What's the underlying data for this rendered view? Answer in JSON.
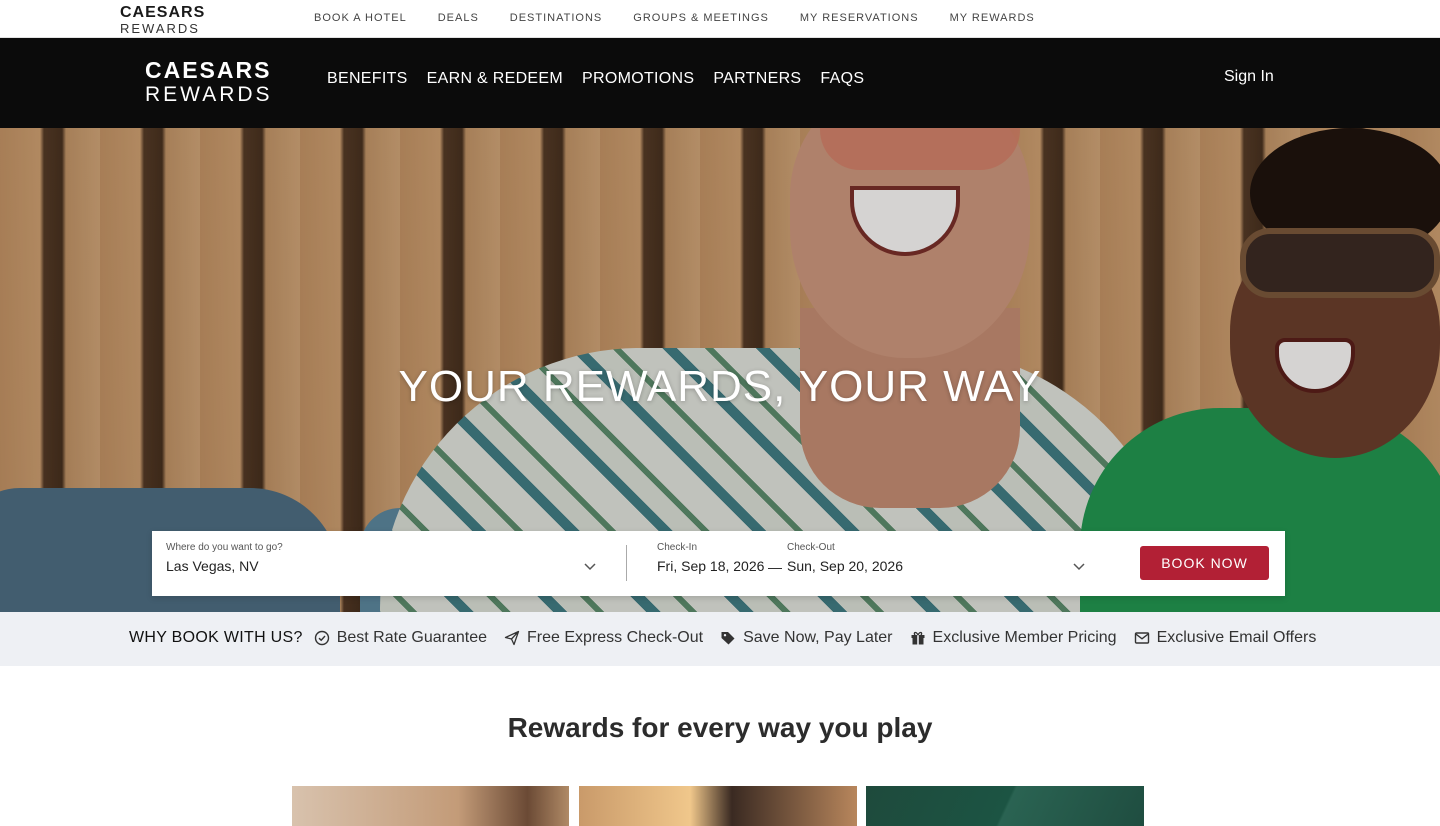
{
  "utility": {
    "logo_line1": "CAESARS",
    "logo_line2": "REWARDS",
    "nav": [
      "BOOK A HOTEL",
      "DEALS",
      "DESTINATIONS",
      "GROUPS & MEETINGS",
      "MY RESERVATIONS",
      "MY REWARDS"
    ]
  },
  "header": {
    "logo_line1": "CAESARS",
    "logo_line2": "REWARDS",
    "nav": [
      "BENEFITS",
      "EARN & REDEEM",
      "PROMOTIONS",
      "PARTNERS",
      "FAQS"
    ],
    "sign_in": "Sign In"
  },
  "hero": {
    "title": "YOUR REWARDS, YOUR WAY"
  },
  "booking": {
    "destination_label": "Where do you want to go?",
    "destination_value": "Las Vegas, NV",
    "checkin_label": "Check-In",
    "checkin_value": "Fri, Sep 18, 2026",
    "separator": "—",
    "checkout_label": "Check-Out",
    "checkout_value": "Sun, Sep 20, 2026",
    "button": "BOOK NOW"
  },
  "why": {
    "title": "WHY BOOK WITH US?",
    "items": [
      {
        "label": "Best Rate Guarantee",
        "icon": "check-circle-icon"
      },
      {
        "label": "Free Express Check-Out",
        "icon": "paper-plane-icon"
      },
      {
        "label": "Save Now, Pay Later",
        "icon": "tag-icon"
      },
      {
        "label": "Exclusive Member Pricing",
        "icon": "gift-icon"
      },
      {
        "label": "Exclusive Email Offers",
        "icon": "envelope-icon"
      }
    ]
  },
  "section": {
    "title": "Rewards for every way you play"
  },
  "colors": {
    "header_bg": "#0b0b0b",
    "accent": "#b22035",
    "why_bar_bg": "#eef0f4"
  }
}
